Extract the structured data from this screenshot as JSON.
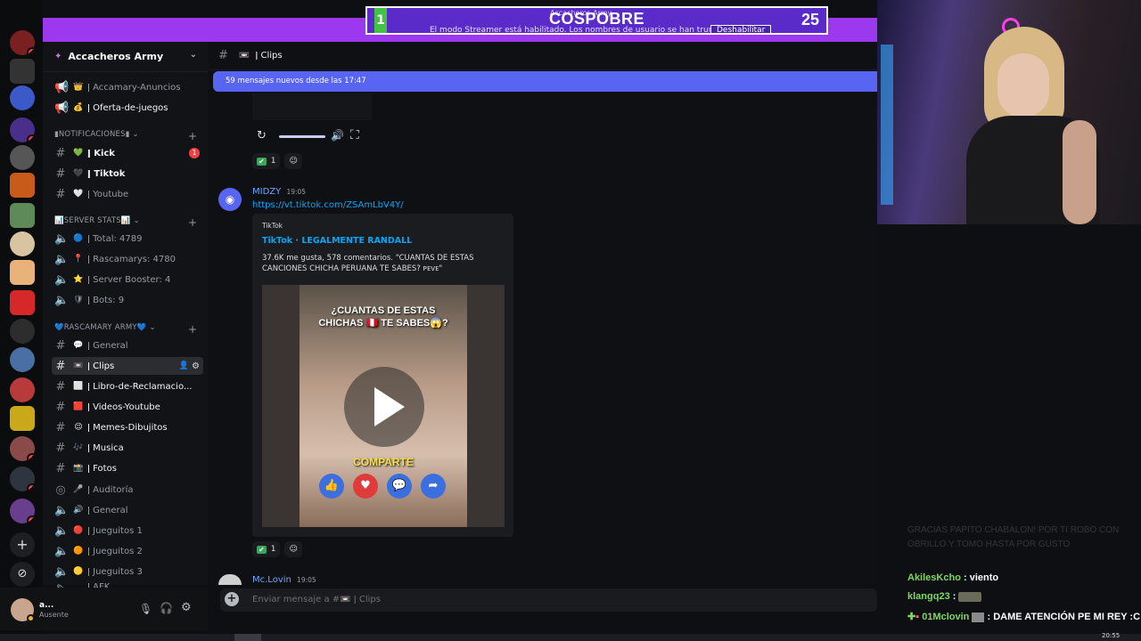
{
  "streamer": {
    "left_score": "1",
    "right_score": "25",
    "title": "COSPOBRE",
    "server_tag": "Accacheros Army",
    "notice": "El modo Streamer está habilitado. Los nombres de usuario se han truncado.",
    "disable_button": "Deshabilitar"
  },
  "rail": {
    "badges": [
      "6",
      "4",
      "1",
      "3",
      "3"
    ]
  },
  "guild": {
    "name": "Accacheros Army"
  },
  "channels": {
    "top": [
      {
        "emoji": "👑",
        "label": "Accamary-Anuncios"
      },
      {
        "emoji": "💰",
        "label": "Oferta-de-juegos"
      }
    ],
    "cat_notifications": "▮NOTIFICACIONES▮",
    "notifications": [
      {
        "emoji": "💚",
        "label": "Kick",
        "badge": "1"
      },
      {
        "emoji": "🖤",
        "label": "Tiktok"
      },
      {
        "emoji": "🤍",
        "label": "Youtube"
      }
    ],
    "cat_stats": "📊SERVER STATS📊",
    "stats": [
      {
        "emoji": "🔵",
        "label": "Total: 4789"
      },
      {
        "emoji": "📍",
        "label": "Rascamarys: 4780"
      },
      {
        "emoji": "⭐",
        "label": "Server Booster: 4"
      },
      {
        "emoji": "🛡",
        "label": "Bots: 9"
      }
    ],
    "cat_army": "💙RASCAMARY ARMY💙",
    "army": [
      {
        "emoji": "💬",
        "label": "General"
      },
      {
        "emoji": "📼",
        "label": "Clips"
      },
      {
        "emoji": "⬜",
        "label": "Libro-de-Reclamacio..."
      },
      {
        "emoji": "🟥",
        "label": "Videos-Youtube"
      },
      {
        "emoji": "😉",
        "label": "Memes-Dibujitos"
      },
      {
        "emoji": "🎶",
        "label": "Musica"
      },
      {
        "emoji": "📸",
        "label": "Fotos"
      },
      {
        "emoji": "🎤",
        "label": "Auditoría"
      },
      {
        "emoji": "🔊",
        "label": "General"
      },
      {
        "emoji": "🔴",
        "label": "Jueguitos 1"
      },
      {
        "emoji": "🟠",
        "label": "Jueguitos 2"
      },
      {
        "emoji": "🟡",
        "label": "Jueguitos 3"
      },
      {
        "emoji": "",
        "label": "AFK"
      }
    ]
  },
  "user": {
    "name": "a...",
    "status": "Ausente"
  },
  "chat": {
    "channel_name": "Clips",
    "new_messages": "59 mensajes nuevos desde las 17:47",
    "reaction_count_1": "1",
    "author": "MIDZY",
    "time": "19:05",
    "link": "https://vt.tiktok.com/ZSAmLbV4Y/",
    "embed_provider": "TikTok",
    "embed_title": "TikTok · LEGALMENTE RANDALL",
    "embed_desc": "37.6K me gusta, 578 comentarios. \"CUANTAS DE ESTAS CANCIONES CHICHA PERUANA TE SABES? ᴘᴇᴠᴇ\"",
    "video_caption": "¿CUANTAS DE ESTAS CHICHAS 🇵🇪 TE SABES😱?",
    "video_share": "COMPARTE",
    "reaction_count_2": "1",
    "next_author": "Mc.Lovin",
    "next_time": "19:05",
    "composer_placeholder": "Enviar mensaje a #📼 ǀ Clips"
  },
  "twitch": {
    "faded": "GRACIAS PAPITO CHABALON! POR TI ROBO CON OBRILLO Y TOMO HASTA POR GUSTO",
    "lines": [
      {
        "user": "AkilesKcho",
        "text": ": viento",
        "color": "#7cd95b"
      },
      {
        "user": "klangq23",
        "text": ":",
        "color": "#7cd95b"
      },
      {
        "user": "01Mclovin",
        "text": ": DAME ATENCIÓN PE MI REY :C",
        "color": "#7cd95b"
      }
    ]
  },
  "taskbar": {
    "time": "20:55"
  }
}
